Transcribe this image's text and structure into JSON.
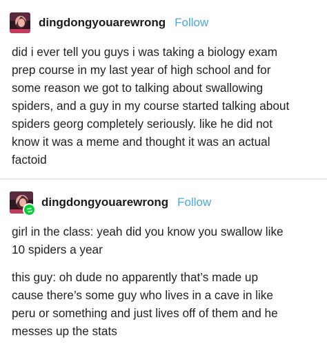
{
  "posts": [
    {
      "username": "dingdongyouarewrong",
      "follow_label": "Follow",
      "avatar_icon": "avatar-image",
      "paragraphs": [
        [
          "did i ever tell you guys i was taking a biology exam",
          "prep course in my last year of high school and for",
          "some reason we got to talking about swallowing",
          "spiders, and a guy in my course started talking about",
          "spiders georg completely seriously. like he did not",
          "know it was a meme and thought it was an actual",
          "factoid"
        ]
      ]
    },
    {
      "username": "dingdongyouarewrong",
      "follow_label": "Follow",
      "avatar_icon": "avatar-image",
      "badge_icon": "reblog-icon",
      "paragraphs": [
        [
          "girl in the class: yeah did you know you swallow like",
          "10 spiders a year"
        ],
        [
          "this guy: oh dude no apparently that’s made up",
          "cause there’s some guy who lives in a cave in like",
          "peru or something and just lives off of them and he",
          "messes up the stats"
        ]
      ]
    }
  ],
  "colors": {
    "follow": "#4aa8d8",
    "reblog_badge": "#00cf35",
    "divider": "#e8e8e8"
  }
}
